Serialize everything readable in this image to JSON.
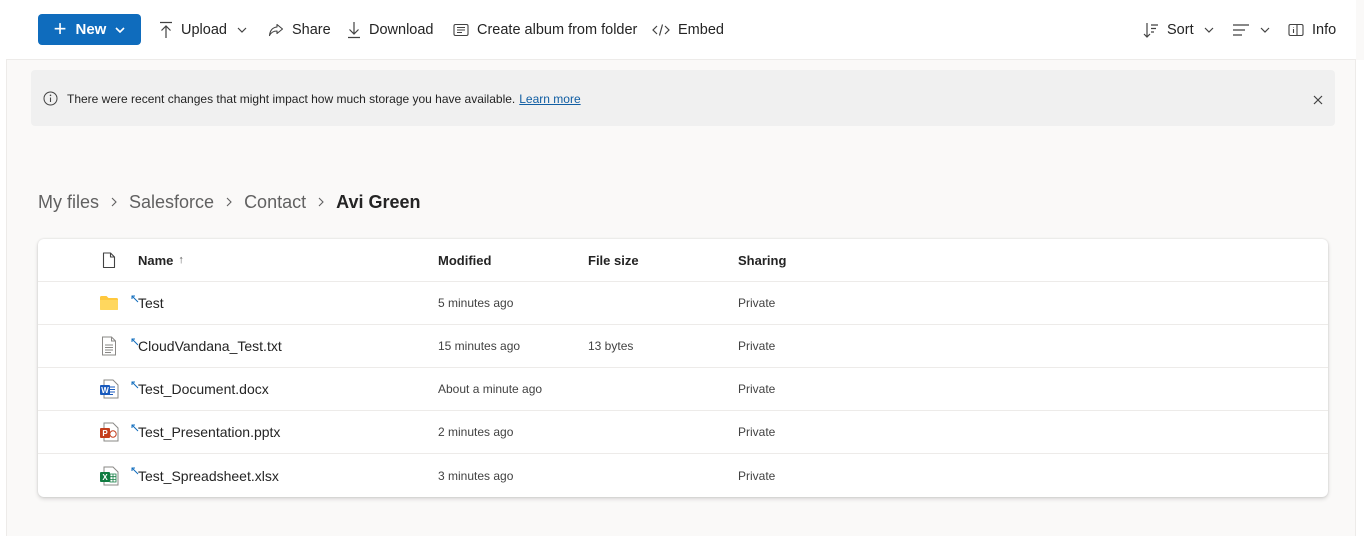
{
  "toolbar": {
    "new_label": "New",
    "upload_label": "Upload",
    "share_label": "Share",
    "download_label": "Download",
    "album_label": "Create album from folder",
    "embed_label": "Embed",
    "sort_label": "Sort",
    "info_label": "Info"
  },
  "banner": {
    "message": "There were recent changes that might impact how much storage you have available.",
    "link": "Learn more"
  },
  "breadcrumb": {
    "items": [
      "My files",
      "Salesforce",
      "Contact"
    ],
    "current": "Avi Green"
  },
  "table": {
    "headers": {
      "name": "Name",
      "name_sort": "↑",
      "modified": "Modified",
      "size": "File size",
      "sharing": "Sharing"
    },
    "rows": [
      {
        "icon": "folder-icon",
        "name": "Test",
        "modified": "5 minutes ago",
        "size": "",
        "sharing": "Private"
      },
      {
        "icon": "text-file-icon",
        "name": "CloudVandana_Test.txt",
        "modified": "15 minutes ago",
        "size": "13 bytes",
        "sharing": "Private"
      },
      {
        "icon": "word-file-icon",
        "name": "Test_Document.docx",
        "modified": "About a minute ago",
        "size": "",
        "sharing": "Private"
      },
      {
        "icon": "powerpoint-file-icon",
        "name": "Test_Presentation.pptx",
        "modified": "2 minutes ago",
        "size": "",
        "sharing": "Private"
      },
      {
        "icon": "excel-file-icon",
        "name": "Test_Spreadsheet.xlsx",
        "modified": "3 minutes ago",
        "size": "",
        "sharing": "Private"
      }
    ]
  },
  "colors": {
    "accent": "#0f6cbd",
    "folder": "#ffc83d",
    "word": "#185abd",
    "powerpoint": "#c43e1c",
    "excel": "#107c41"
  }
}
